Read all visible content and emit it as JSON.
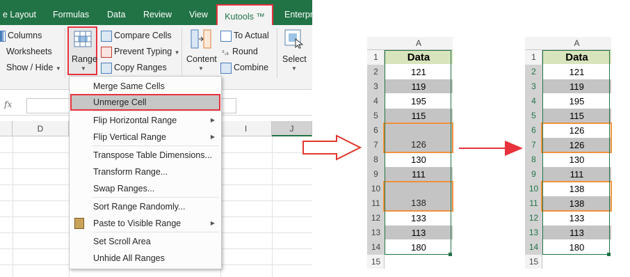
{
  "ribbon": {
    "tabs": [
      "e Layout",
      "Formulas",
      "Data",
      "Review",
      "View",
      "Kutools ™",
      "Enterpri"
    ],
    "left_group": [
      "Columns",
      "Worksheets",
      "Show / Hide"
    ],
    "range_button": "Range",
    "compare_group": [
      "Compare Cells",
      "Prevent Typing",
      "Copy Ranges"
    ],
    "content_button": "Content",
    "convert_group": [
      "To Actual",
      "Round",
      "Combine"
    ],
    "select_button": "Select"
  },
  "formula_bar": {
    "fx": "fx"
  },
  "column_headers": [
    "D",
    "I",
    "J"
  ],
  "menu": {
    "items": [
      {
        "label": "Merge Same Cells",
        "submenu": false
      },
      {
        "label": "Unmerge Cell",
        "submenu": false,
        "highlighted": true
      },
      {
        "label": "Flip Horizontal Range",
        "submenu": true
      },
      {
        "label": "Flip Vertical Range",
        "submenu": true
      },
      {
        "label": "Transpose Table Dimensions...",
        "submenu": false
      },
      {
        "label": "Transform Range...",
        "submenu": false
      },
      {
        "label": "Swap Ranges...",
        "submenu": false
      },
      {
        "label": "Sort Range Randomly...",
        "submenu": false
      },
      {
        "label": "Paste to Visible Range",
        "submenu": true
      },
      {
        "label": "Set Scroll Area",
        "submenu": false
      },
      {
        "label": "Unhide All Ranges",
        "submenu": false
      }
    ]
  },
  "sheet_before": {
    "column": "A",
    "rows": [
      "1",
      "2",
      "3",
      "4",
      "5",
      "6",
      "7",
      "8",
      "9",
      "10",
      "11",
      "12",
      "13",
      "14",
      "15"
    ],
    "header": "Data",
    "values": [
      "121",
      "119",
      "195",
      "115",
      "",
      "126",
      "130",
      "111",
      "",
      "138",
      "133",
      "113",
      "180"
    ]
  },
  "sheet_after": {
    "column": "A",
    "rows": [
      "1",
      "2",
      "3",
      "4",
      "5",
      "6",
      "7",
      "8",
      "9",
      "10",
      "11",
      "12",
      "13",
      "14",
      "15"
    ],
    "header": "Data",
    "values": [
      "121",
      "119",
      "195",
      "115",
      "126",
      "126",
      "130",
      "111",
      "138",
      "138",
      "133",
      "113",
      "180"
    ]
  },
  "colors": {
    "excel_green": "#217346",
    "highlight_red": "#e8323c",
    "merge_orange": "#f0913a",
    "header_green": "#d8e4bc",
    "cell_gray": "#c4c4c4"
  }
}
